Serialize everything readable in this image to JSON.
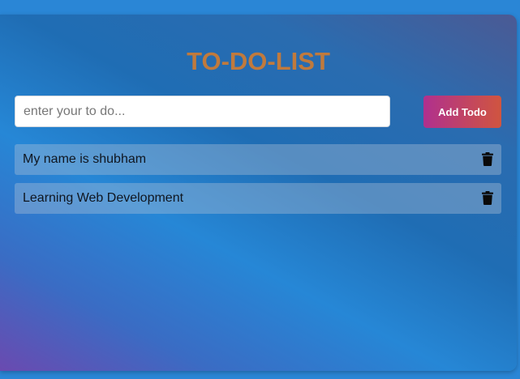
{
  "app": {
    "title": "TO-DO-LIST"
  },
  "input": {
    "value": "",
    "placeholder": "enter your to do..."
  },
  "add_button": {
    "label": "Add Todo"
  },
  "todos": [
    {
      "text": "My name is shubham",
      "icon": "trash-icon"
    },
    {
      "text": "Learning Web Development",
      "icon": "trash-icon"
    }
  ],
  "colors": {
    "title": "#c07a3d",
    "button_gradient_start": "#b0308e",
    "button_gradient_end": "#d0553f",
    "background": "#2a86d6"
  }
}
